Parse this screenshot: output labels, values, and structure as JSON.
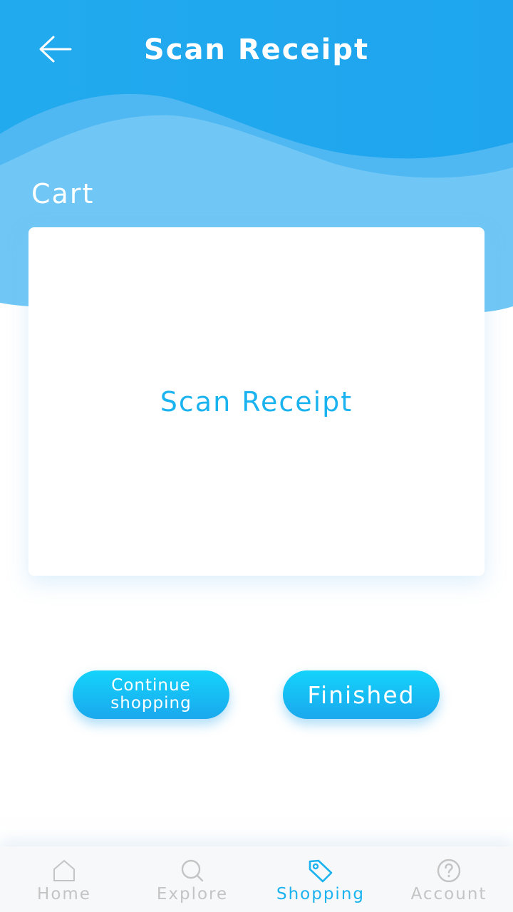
{
  "header": {
    "title": "Scan Receipt",
    "back_icon": "arrow-left-icon"
  },
  "cart": {
    "title": "Cart",
    "scan_label": "Scan Receipt"
  },
  "actions": {
    "continue_label": "Continue shopping",
    "finished_label": "Finished"
  },
  "nav": {
    "items": [
      {
        "label": "Home",
        "icon": "home-icon",
        "active": false
      },
      {
        "label": "Explore",
        "icon": "search-icon",
        "active": false
      },
      {
        "label": "Shopping",
        "icon": "tag-icon",
        "active": true
      },
      {
        "label": "Account",
        "icon": "help-circle-icon",
        "active": false
      }
    ]
  },
  "colors": {
    "accent": "#1ab3f0",
    "header_top": "#1ea7ee",
    "header_wave": "#6ec6f5",
    "inactive": "#c4c4c4"
  }
}
